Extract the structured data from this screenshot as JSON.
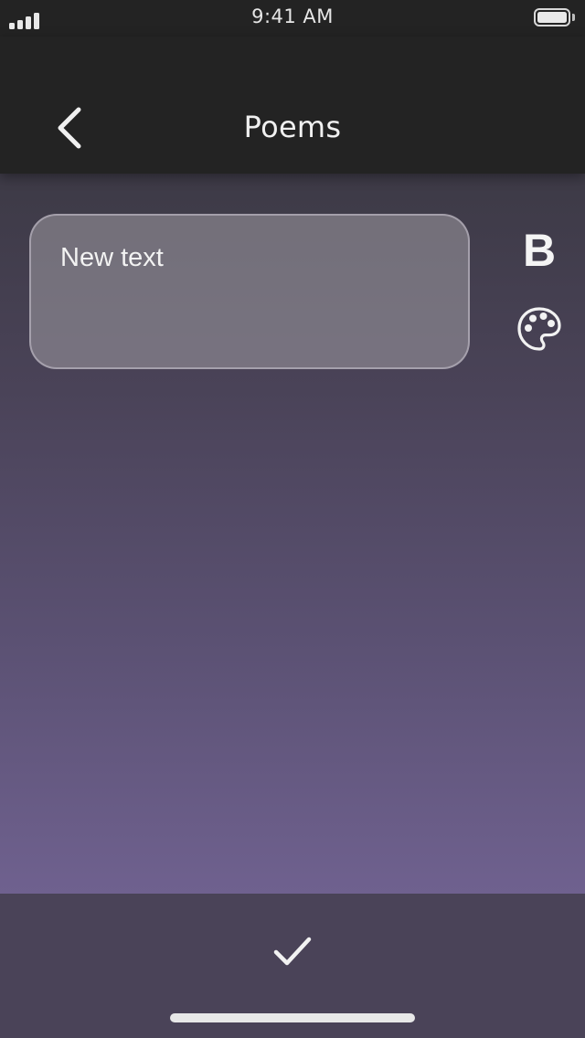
{
  "status_bar": {
    "time": "9:41 AM",
    "signal_icon": "cellular-signal-icon",
    "battery_icon": "battery-full-icon"
  },
  "nav": {
    "title": "Poems",
    "back_icon": "chevron-left-icon"
  },
  "editor": {
    "text_value": "New text",
    "bold_label": "B",
    "bold_icon": "bold-format-icon",
    "palette_icon": "color-palette-icon"
  },
  "bottom_bar": {
    "confirm_icon": "checkmark-icon"
  },
  "colors": {
    "header_bg": "#232323",
    "gradient_top": "#3d3a46",
    "gradient_bottom": "#6f618f",
    "bottom_bar_bg": "#4a4358",
    "text_box_bg": "#8a868f",
    "foreground": "#f0f0f0"
  }
}
